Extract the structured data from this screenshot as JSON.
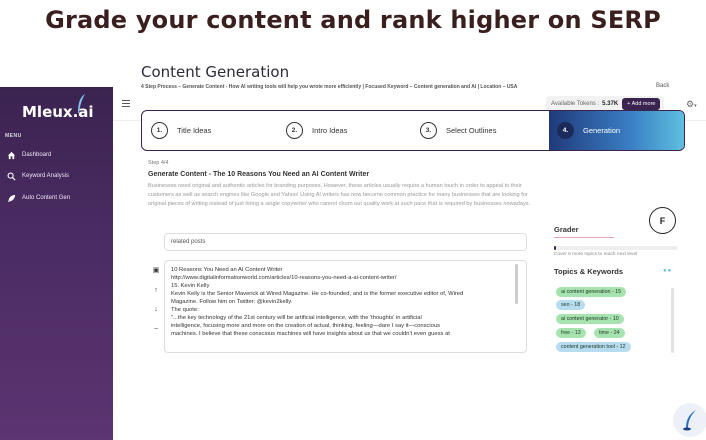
{
  "headline": "Grade your content and rank higher on SERP",
  "brand": {
    "logo_text": "Mleux.ai"
  },
  "sidebar": {
    "menu_label": "MENU",
    "items": [
      {
        "label": "Dashboard",
        "icon": "home-icon"
      },
      {
        "label": "Keyword Analysis",
        "icon": "search-icon"
      },
      {
        "label": "Auto Content Gen",
        "icon": "rocket-icon"
      }
    ]
  },
  "topbar": {
    "tokens_label": "Available Tokens :",
    "tokens_value": "5.37K",
    "add_more_label": "+ Add more",
    "settings_icon": "gear-icon"
  },
  "page": {
    "title": "Content Generation",
    "subline": "4 Step Process – Generate Content - How AI writing tools will help you wrote more efficiently | Focused Keyword – Content generation and AI | Location – USA",
    "back_label": "Back"
  },
  "steps": [
    {
      "num": "1.",
      "label": "Title Ideas",
      "active": false
    },
    {
      "num": "2.",
      "label": "Intro Ideas",
      "active": false
    },
    {
      "num": "3.",
      "label": "Select Outlines",
      "active": false
    },
    {
      "num": "4.",
      "label": "Generation",
      "active": true
    }
  ],
  "generation": {
    "step_label": "Step 4/4",
    "title": "Generate Content - The 10 Reasons You Need an AI Content Writer",
    "description": "Businesses need original and authentic articles for branding purposes. However, these articles usually require a human touch in order to appeal to their customers as well as search engines like Google and Yahoo! Using AI writers has now become common practice for many businesses that are looking for original pieces of writing instead of just hiring a single copywriter who cannot churn out quality work at such pace that is required by businesses nowadays."
  },
  "editor": {
    "related_placeholder": "related posts",
    "lines": [
      " 10 Reasons You Need an AI Content Writer",
      "http://www.digitalinformationworld.com/articles/10-reasons-you-need-a-ai-content-writer/",
      "15. Kevin Kelly",
      "Kevin Kelly is the Senior Maverick at Wired Magazine. He co-founded, and is the former executive editor of, Wired",
      "Magazine. Follow him on Twitter: @kevin2kelly.",
      "The quote:",
      "\"...the key technology of the 21st century will be artificial intelligence, with the 'thoughts' in artificial",
      "intelligence, focusing more and more on the creation of actual, thinking, feeling—dare I say it—conscious",
      "machines. I believe that these conscious machines will have insights about us that we couldn't even guess at"
    ]
  },
  "grader": {
    "grade": "F",
    "title": "Grader",
    "progress": 0.02,
    "note": "Cover 6 more topics to reach next level"
  },
  "topics": {
    "title": "Topics & Keywords",
    "chips": [
      {
        "label": "ai content generation - 15",
        "color": "#a7e3b0"
      },
      {
        "label": "seo - 18",
        "color": "#b7dbef"
      },
      {
        "label": "ai content generator - 10",
        "color": "#a7e3b0"
      },
      {
        "label": "free - 13",
        "color": "#a7e3b0"
      },
      {
        "label": "time - 24",
        "color": "#a7e3b0"
      },
      {
        "label": "content generation tool - 12",
        "color": "#b7dbef"
      }
    ]
  },
  "colors": {
    "brand": "#3b2350",
    "accent_blue": "#3a7fc4",
    "chip_green": "#a7e3b0"
  }
}
